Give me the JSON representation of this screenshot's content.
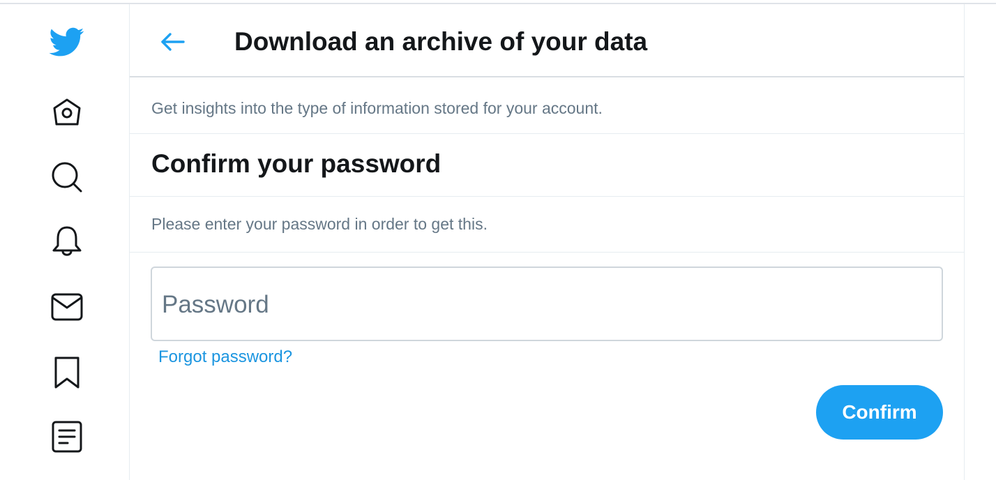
{
  "colors": {
    "brand": "#1da1f2",
    "link": "#1b95e0",
    "text_primary": "#14171a",
    "text_secondary": "#657786"
  },
  "sidebar": {
    "items": [
      {
        "icon": "twitter-bird-logo-icon"
      },
      {
        "icon": "home-icon"
      },
      {
        "icon": "search-icon"
      },
      {
        "icon": "notifications-bell-icon"
      },
      {
        "icon": "messages-envelope-icon"
      },
      {
        "icon": "bookmark-icon"
      },
      {
        "icon": "lists-icon"
      }
    ]
  },
  "header": {
    "back_icon": "arrow-left-icon",
    "title": "Download an archive of your data"
  },
  "main": {
    "subtitle": "Get insights into the type of information stored for your account.",
    "confirm_heading": "Confirm your password",
    "instructions": "Please enter your password in order to get this.",
    "password": {
      "placeholder": "Password",
      "value": ""
    },
    "forgot_link": "Forgot password?",
    "confirm_button": "Confirm"
  }
}
